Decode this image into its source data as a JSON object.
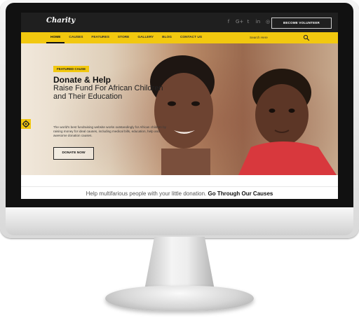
{
  "site": {
    "logo": "Charity"
  },
  "topbar": {
    "socials": [
      {
        "icon": "facebook-icon",
        "glyph": "f"
      },
      {
        "icon": "google-plus-icon",
        "glyph": "G+"
      },
      {
        "icon": "twitter-icon",
        "glyph": "t"
      },
      {
        "icon": "linkedin-icon",
        "glyph": "in"
      },
      {
        "icon": "instagram-icon",
        "glyph": "◎"
      }
    ],
    "volunteer_label": "BECOME VOLUNTEER"
  },
  "nav": {
    "items": [
      "HOME",
      "CAUSES",
      "FEATURES",
      "STORE",
      "GALLERY",
      "BLOG",
      "CONTACT US"
    ],
    "active_index": 0,
    "search_placeholder": "Search Here"
  },
  "hero": {
    "badge": "FEATURED CAUSE",
    "title": "Donate & Help",
    "subtitle": "Raise Fund For African Children and Their Education",
    "description": "The world's best fundraising website works outstandingly for African children by raising money for ideal causes, including medical bills, education, help and awesome donation causes.",
    "cta": "DONATE NOW",
    "slides": {
      "count": 3,
      "active": 0
    }
  },
  "below": {
    "lead": "Help multifarious people with your little donation.",
    "emphasis": "Go Through Our Causes"
  },
  "colors": {
    "accent": "#f2c80f",
    "topbar": "#1f1f1f"
  }
}
